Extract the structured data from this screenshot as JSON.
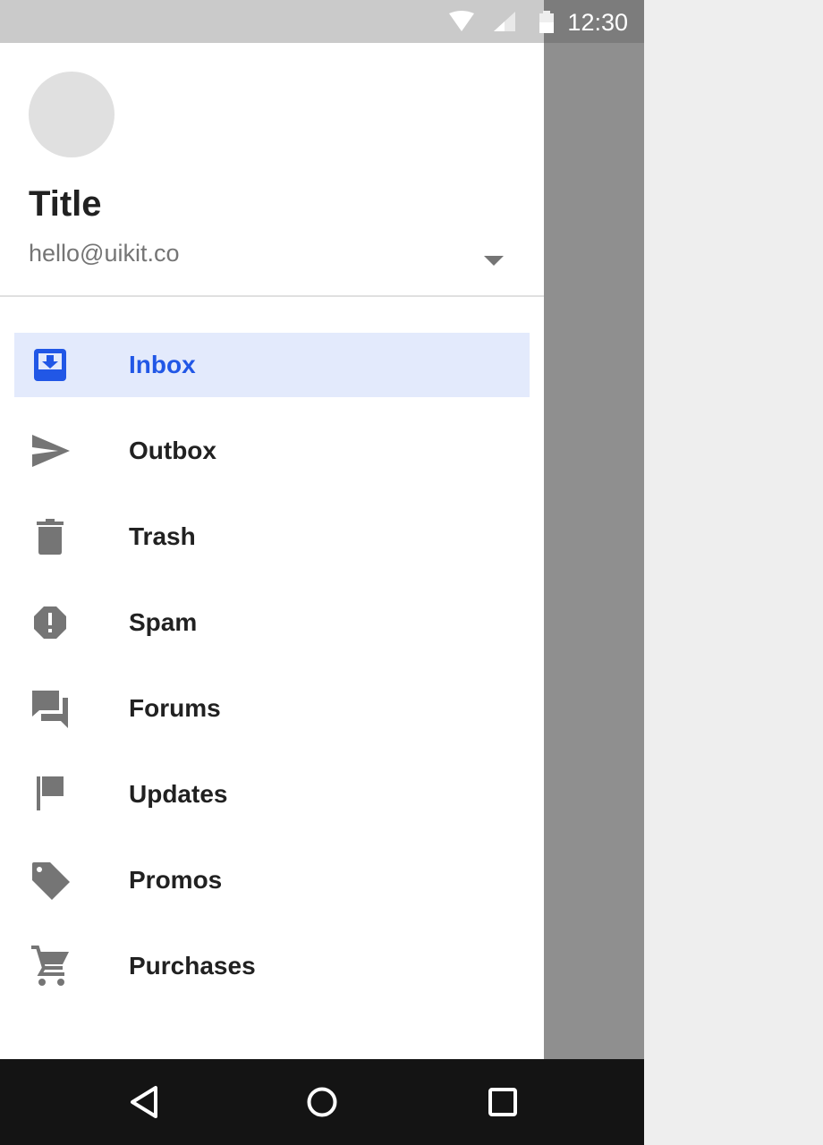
{
  "status_bar": {
    "time": "12:30",
    "icons": [
      "wifi-icon",
      "cellular-signal-icon",
      "battery-icon"
    ]
  },
  "drawer_header": {
    "title": "Title",
    "email": "hello@uikit.co"
  },
  "nav_items": [
    {
      "label": "Inbox",
      "icon": "inbox-icon",
      "active": true
    },
    {
      "label": "Outbox",
      "icon": "send-icon",
      "active": false
    },
    {
      "label": "Trash",
      "icon": "trash-icon",
      "active": false
    },
    {
      "label": "Spam",
      "icon": "report-icon",
      "active": false
    },
    {
      "label": "Forums",
      "icon": "forum-icon",
      "active": false
    },
    {
      "label": "Updates",
      "icon": "flag-icon",
      "active": false
    },
    {
      "label": "Promos",
      "icon": "tag-icon",
      "active": false
    },
    {
      "label": "Purchases",
      "icon": "cart-icon",
      "active": false
    }
  ],
  "system_nav": [
    "back-icon",
    "home-icon",
    "recents-icon"
  ],
  "colors": {
    "accent": "#2157e6",
    "active_background": "#e3eafc",
    "icon_gray": "#757575",
    "scrim": "#8f8f8f"
  }
}
